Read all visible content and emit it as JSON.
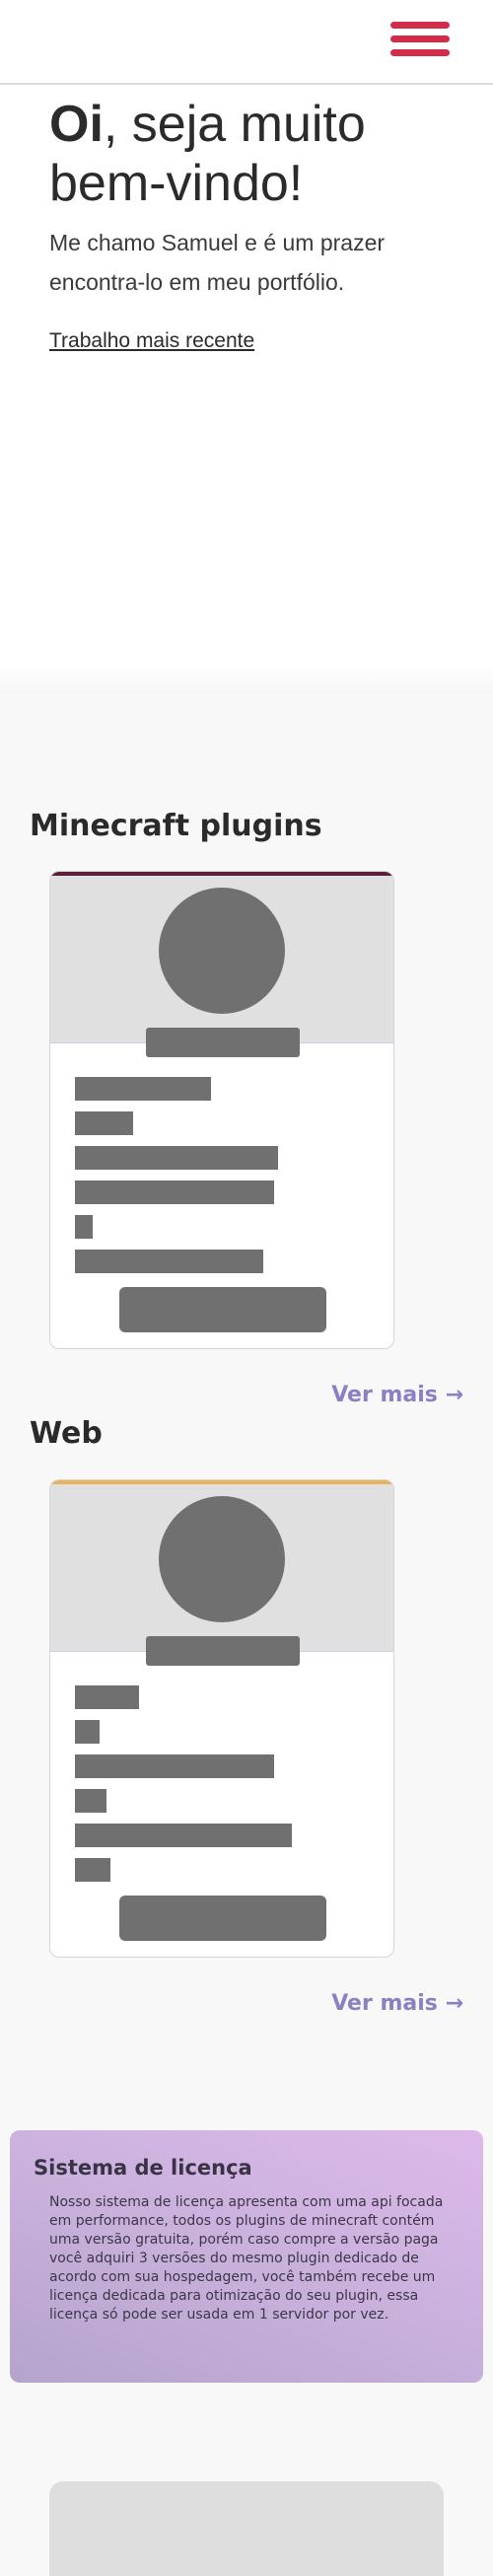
{
  "colors": {
    "menu": "#d12c4a",
    "minecraft_accent": "#5a1f3a",
    "web_accent": "#e7b25a",
    "link": "#8e7fc4"
  },
  "header": {
    "menu_icon": "hamburger-menu-icon"
  },
  "hero": {
    "greeting_bold": "Oi",
    "greeting_rest": ", seja muito bem-vindo!",
    "intro": "Me chamo Samuel e é um prazer encontra-lo em meu portfólio.",
    "recent_link": "Trabalho mais recente"
  },
  "sections": {
    "minecraft": {
      "title": "Minecraft plugins",
      "see_more": "Ver mais"
    },
    "web": {
      "title": "Web",
      "see_more": "Ver mais"
    }
  },
  "license": {
    "title": "Sistema de licença",
    "text": "Nosso sistema de licença apresenta com uma api focada em performance, todos os plugins de minecraft contém uma versão gratuita, porém caso compre a versão paga você adquiri 3 versões do mesmo plugin dedicado de acordo com sua hospedagem, você também recebe um licença dedicada para otimização do seu plugin, essa licença só pode ser usada em 1 servidor por vez."
  }
}
